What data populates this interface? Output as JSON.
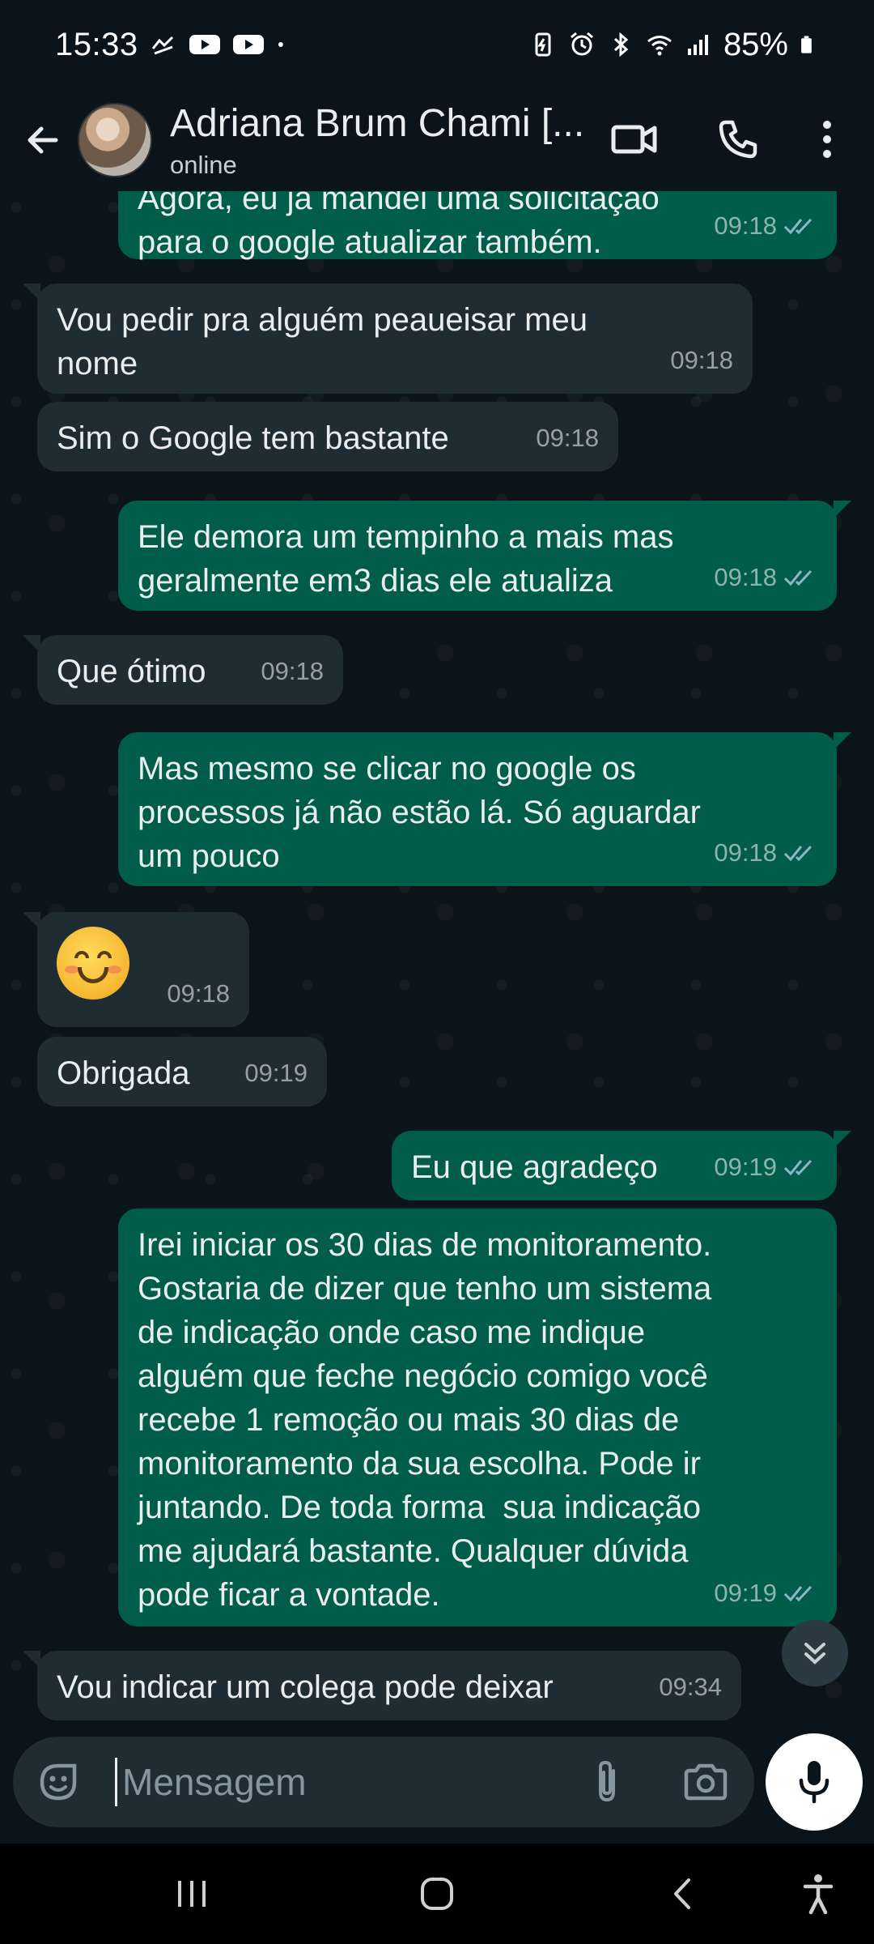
{
  "status_bar": {
    "time": "15:33",
    "battery": "85%",
    "icons": [
      "missed-call-icon",
      "youtube-icon",
      "youtube-icon",
      "dot-icon",
      "battery-saver-icon",
      "alarm-icon",
      "bluetooth-icon",
      "wifi-icon",
      "signal-icon",
      "battery-icon"
    ]
  },
  "header": {
    "contact_name": "Adriana Brum Chami [...",
    "status": "online",
    "icons": [
      "back-arrow-icon",
      "video-call-icon",
      "phone-icon",
      "more-vert-icon"
    ]
  },
  "messages": [
    {
      "direction": "out",
      "text": "Agora, eu já mandei uma solicitação\npara o google atualizar também.",
      "time": "09:18",
      "read": true
    },
    {
      "direction": "in",
      "text": "Vou pedir pra alguém peaueisar meu\nnome",
      "time": "09:18"
    },
    {
      "direction": "in",
      "text": "Sim o Google tem bastante",
      "time": "09:18"
    },
    {
      "direction": "out",
      "text": "Ele demora um tempinho a mais mas\ngeralmente em3 dias ele atualiza",
      "time": "09:18",
      "read": true
    },
    {
      "direction": "in",
      "text": "Que ótimo",
      "time": "09:18"
    },
    {
      "direction": "out",
      "text": "Mas mesmo se clicar no google os\nprocessos já não estão lá. Só aguardar\num pouco",
      "time": "09:18",
      "read": true
    },
    {
      "direction": "in",
      "emoji": "smiling-face-icon",
      "time": "09:18"
    },
    {
      "direction": "in",
      "text": "Obrigada",
      "time": "09:19"
    },
    {
      "direction": "out",
      "text": "Eu que agradeço",
      "time": "09:19",
      "read": true
    },
    {
      "direction": "out",
      "text": "Irei iniciar os 30 dias de monitoramento.\nGostaria de dizer que tenho um sistema\nde indicação onde caso me indique\nalguém que feche negócio comigo você\nrecebe 1 remoção ou mais 30 dias de\nmonitoramento da sua escolha. Pode ir\njuntando. De toda forma  sua indicação\nme ajudará bastante. Qualquer dúvida\npode ficar a vontade.",
      "time": "09:19",
      "read": true
    },
    {
      "direction": "in",
      "text": "Vou indicar um colega pode deixar",
      "time": "09:34"
    }
  ],
  "composer": {
    "placeholder": "Mensagem",
    "value": "",
    "icons": [
      "sticker-icon",
      "attach-icon",
      "camera-icon",
      "mic-icon"
    ]
  },
  "nav_bar": {
    "icons": [
      "recent-apps-icon",
      "home-icon",
      "back-icon",
      "accessibility-icon"
    ]
  },
  "colors": {
    "background": "#0b141a",
    "incoming_bubble": "#202c33",
    "outgoing_bubble": "#005c4b",
    "read_ticks": "#8fb5c9"
  }
}
